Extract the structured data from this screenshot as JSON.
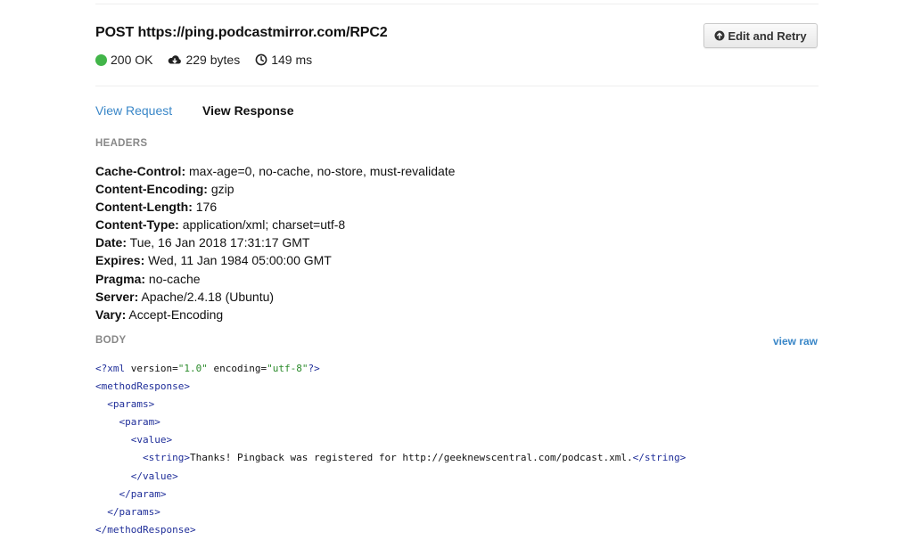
{
  "request": {
    "title": "POST https://ping.podcastmirror.com/RPC2",
    "status": "200 OK",
    "size": "229 bytes",
    "time": "149 ms",
    "status_color": "#42b549",
    "icons": {
      "status": "status-dot-icon",
      "size": "cloud-download-icon",
      "time": "clock-icon"
    }
  },
  "toolbar": {
    "edit_retry_label": "Edit and Retry",
    "edit_retry_icon": "circle-arrow-up-icon"
  },
  "tabs": [
    {
      "label": "View Request",
      "active": false
    },
    {
      "label": "View Response",
      "active": true
    }
  ],
  "sections": {
    "headers_label": "HEADERS",
    "body_label": "BODY",
    "view_raw_label": "view raw"
  },
  "headers": [
    {
      "name": "Cache-Control:",
      "value": "max-age=0, no-cache, no-store, must-revalidate"
    },
    {
      "name": "Content-Encoding:",
      "value": "gzip"
    },
    {
      "name": "Content-Length:",
      "value": "176"
    },
    {
      "name": "Content-Type:",
      "value": "application/xml; charset=utf-8"
    },
    {
      "name": "Date:",
      "value": "Tue, 16 Jan 2018 17:31:17 GMT"
    },
    {
      "name": "Expires:",
      "value": "Wed, 11 Jan 1984 05:00:00 GMT"
    },
    {
      "name": "Pragma:",
      "value": "no-cache"
    },
    {
      "name": "Server:",
      "value": "Apache/2.4.18 (Ubuntu)"
    },
    {
      "name": "Vary:",
      "value": "Accept-Encoding"
    }
  ],
  "body": {
    "decl_open": "<?xml",
    "decl_attr1": "version=",
    "decl_val1": "\"1.0\"",
    "decl_attr2": "encoding=",
    "decl_val2": "\"utf-8\"",
    "decl_close": "?>",
    "lines": [
      {
        "indent": 0,
        "tag": "<methodResponse>",
        "text": "",
        "close": ""
      },
      {
        "indent": 1,
        "tag": "<params>",
        "text": "",
        "close": ""
      },
      {
        "indent": 2,
        "tag": "<param>",
        "text": "",
        "close": ""
      },
      {
        "indent": 3,
        "tag": "<value>",
        "text": "",
        "close": ""
      },
      {
        "indent": 4,
        "tag": "<string>",
        "text": "Thanks! Pingback was registered for http://geeknewscentral.com/podcast.xml.",
        "close": "</string>"
      },
      {
        "indent": 3,
        "tag": "</value>",
        "text": "",
        "close": ""
      },
      {
        "indent": 2,
        "tag": "</param>",
        "text": "",
        "close": ""
      },
      {
        "indent": 1,
        "tag": "</params>",
        "text": "",
        "close": ""
      },
      {
        "indent": 0,
        "tag": "</methodResponse>",
        "text": "",
        "close": ""
      }
    ]
  },
  "colors": {
    "link": "#3a87c8",
    "xml_tag": "#1f2e99",
    "xml_string": "#2a8a2a",
    "muted_label": "#888888"
  }
}
